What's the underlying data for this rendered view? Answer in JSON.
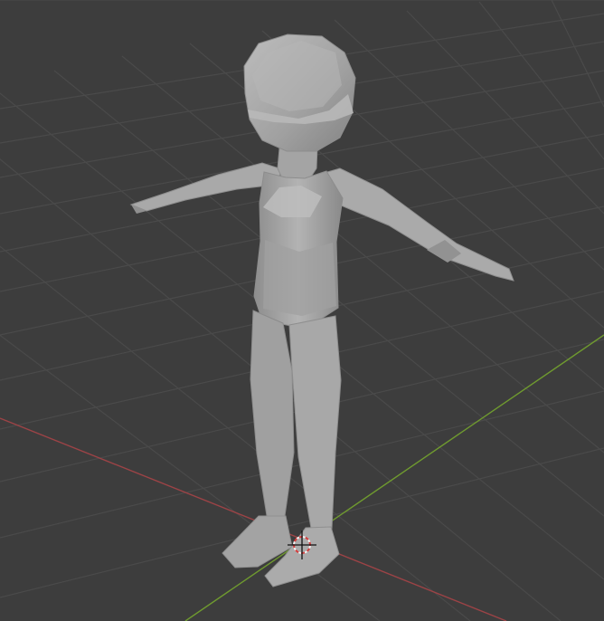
{
  "viewport": {
    "background": "#3d3d3d",
    "grid_color": "#4a4a4a",
    "x_axis_color": "#9c4346",
    "y_axis_color": "#6f9a2f",
    "mesh_color": "#a7a7a7",
    "mesh_shadow": "#7f7f7f",
    "mesh_highlight": "#c7c7c7"
  },
  "scene": {
    "object": "low-poly-humanoid-mesh",
    "pose": "T-pose",
    "cursor_icon": "3d-cursor-icon"
  }
}
